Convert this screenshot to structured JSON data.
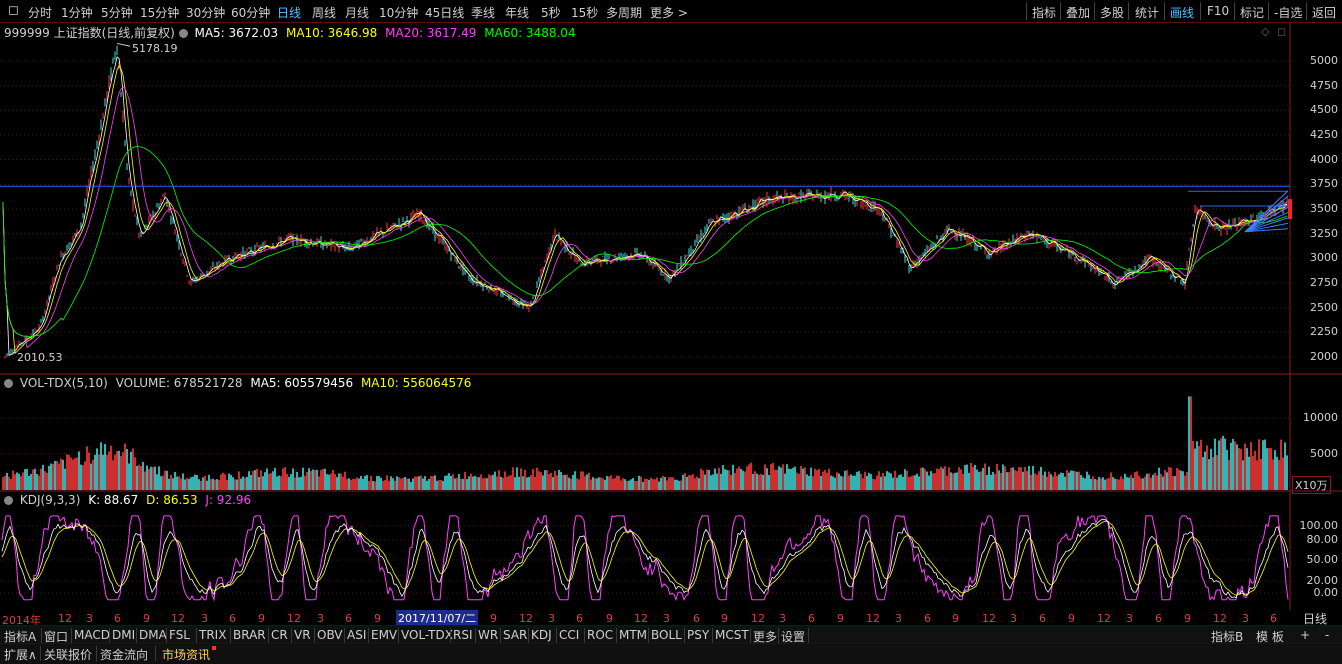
{
  "toolbar": {
    "periods": [
      "分时",
      "1分钟",
      "5分钟",
      "15分钟",
      "30分钟",
      "60分钟",
      "日线",
      "周线",
      "月线",
      "10分钟",
      "45日线",
      "季线",
      "年线",
      "5秒",
      "15秒",
      "多周期",
      "更多 >"
    ],
    "active_period": "日线",
    "right_tools": [
      "指标",
      "叠加",
      "多股",
      "统计",
      "画线",
      "F10",
      "标记",
      "-自选",
      "返回"
    ],
    "active_tool": "画线"
  },
  "price_panel": {
    "code_name": "999999 上证指数(日线,前复权)",
    "ma5": "MA5: 3672.03",
    "ma10": "MA10: 3646.98",
    "ma20": "MA20: 3617.49",
    "ma60": "MA60: 3488.04",
    "high_label": "5178.19",
    "low_label": "2010.53",
    "y_ticks": [
      "5000",
      "4750",
      "4500",
      "4250",
      "4000",
      "3750",
      "3500",
      "3250",
      "3000",
      "2750",
      "2500",
      "2250",
      "2000"
    ],
    "colors": {
      "ma5": "#ffffff",
      "ma10": "#ffff00",
      "ma20": "#ff40ff",
      "ma60": "#00ff00",
      "ref_line": "#3060ff"
    }
  },
  "volume_panel": {
    "name": "VOL-TDX(5,10)",
    "volume": "VOLUME: 678521728",
    "ma5": "MA5: 605579456",
    "ma10": "MA10: 556064576",
    "y_ticks": [
      "10000",
      "5000"
    ],
    "unit": "X10万"
  },
  "kdj_panel": {
    "name": "KDJ(9,3,3)",
    "k": "K: 88.67",
    "d": "D: 86.53",
    "j": "J: 92.96",
    "y_ticks": [
      "100.00",
      "80.00",
      "50.00",
      "20.00",
      "0.00"
    ]
  },
  "date_axis": {
    "labels": [
      "2014年",
      "12",
      "3",
      "6",
      "9",
      "12",
      "3",
      "6",
      "9",
      "12",
      "3",
      "6",
      "9",
      "12",
      "3",
      "6",
      "9",
      "12",
      "3",
      "6",
      "9",
      "12",
      "3",
      "6",
      "9",
      "12",
      "3",
      "6",
      "9",
      "12",
      "3",
      "6",
      "9",
      "12",
      "3",
      "6",
      "9",
      "12",
      "3",
      "6",
      "9",
      "12",
      "3",
      "6"
    ],
    "cursor_date": "2017/11/07/二",
    "period": "日线"
  },
  "indicator_tabs": [
    "指标A",
    "窗口",
    "MACD",
    "DMI",
    "DMA",
    "FSL",
    "TRIX",
    "BRAR",
    "CR",
    "VR",
    "OBV",
    "ASI",
    "EMV",
    "VOL-TDX",
    "RSI",
    "WR",
    "SAR",
    "KDJ",
    "CCI",
    "ROC",
    "MTM",
    "BOLL",
    "PSY",
    "MCST",
    "更多",
    "设置"
  ],
  "indicator_right": [
    "指标B",
    "模 板",
    "+",
    "-"
  ],
  "info_tabs": [
    "扩展∧",
    "关联报价",
    "资金流向",
    "市场资讯"
  ]
}
